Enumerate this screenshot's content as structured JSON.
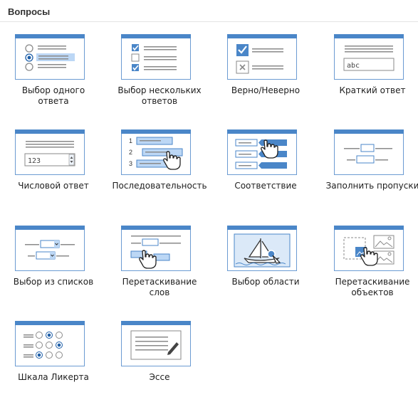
{
  "panel": {
    "title": "Вопросы"
  },
  "questions": [
    {
      "label": "Выбор одного ответа",
      "line1": "Выбор одного",
      "line2": "ответа",
      "icon": "single-choice-icon"
    },
    {
      "label": "Выбор нескольких ответов",
      "line1": "Выбор нескольких",
      "line2": "ответов",
      "icon": "multiple-choice-icon"
    },
    {
      "label": "Верно/Неверно",
      "line1": "Верно/Неверно",
      "line2": "",
      "icon": "true-false-icon"
    },
    {
      "label": "Краткий ответ",
      "line1": "Краткий ответ",
      "line2": "",
      "icon": "short-answer-icon",
      "sample": "abc"
    },
    {
      "label": "Числовой ответ",
      "line1": "Числовой ответ",
      "line2": "",
      "icon": "numeric-icon",
      "sample": "123"
    },
    {
      "label": "Последовательность",
      "line1": "Последовательность",
      "line2": "",
      "icon": "sequence-icon",
      "numbers": [
        "1",
        "2",
        "3"
      ]
    },
    {
      "label": "Соответствие",
      "line1": "Соответствие",
      "line2": "",
      "icon": "matching-icon"
    },
    {
      "label": "Заполнить пропуски",
      "line1": "Заполнить пропуски",
      "line2": "",
      "icon": "fill-in-blanks-icon"
    },
    {
      "label": "Выбор из списков",
      "line1": "Выбор из списков",
      "line2": "",
      "icon": "select-from-lists-icon"
    },
    {
      "label": "Перетаскивание слов",
      "line1": "Перетаскивание",
      "line2": "слов",
      "icon": "drag-words-icon"
    },
    {
      "label": "Выбор области",
      "line1": "Выбор области",
      "line2": "",
      "icon": "hotspot-icon"
    },
    {
      "label": "Перетаскивание объектов",
      "line1": "Перетаскивание",
      "line2": "объектов",
      "icon": "drag-objects-icon"
    },
    {
      "label": "Шкала Ликерта",
      "line1": "Шкала Ликерта",
      "line2": "",
      "icon": "likert-scale-icon"
    },
    {
      "label": "Эссе",
      "line1": "Эссе",
      "line2": "",
      "icon": "essay-icon"
    }
  ],
  "colors": {
    "accent": "#4a86c8",
    "accent_light": "#bcd7f5",
    "frame": "#5a8ec8",
    "text": "#1e1e1e"
  }
}
